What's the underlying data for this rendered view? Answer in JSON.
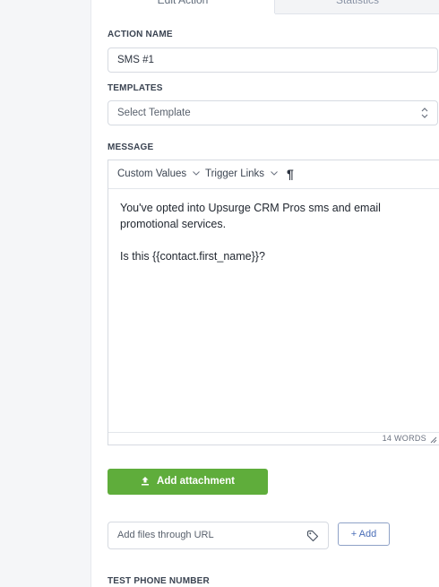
{
  "tabs": [
    {
      "label": "Edit Action",
      "active": true
    },
    {
      "label": "Statistics",
      "active": false
    }
  ],
  "action_name": {
    "label": "ACTION NAME",
    "value": "SMS #1"
  },
  "templates": {
    "label": "TEMPLATES",
    "placeholder": "Select Template"
  },
  "message": {
    "label": "MESSAGE",
    "toolbar": {
      "custom_values": "Custom Values",
      "trigger_links": "Trigger Links",
      "paragraph_icon": "¶"
    },
    "body": {
      "line1": "You've opted into Upsurge CRM Pros sms and email promotional services.",
      "line2": "Is this {{contact.first_name}}?"
    },
    "word_count": "14 WORDS"
  },
  "attachment": {
    "button_label": "Add attachment"
  },
  "url_input": {
    "placeholder": "Add files through URL",
    "add_label": "+ Add"
  },
  "test_phone": {
    "label": "TEST PHONE NUMBER"
  },
  "colors": {
    "primary_green": "#5fad3b",
    "link_blue": "#4a6eb8"
  }
}
